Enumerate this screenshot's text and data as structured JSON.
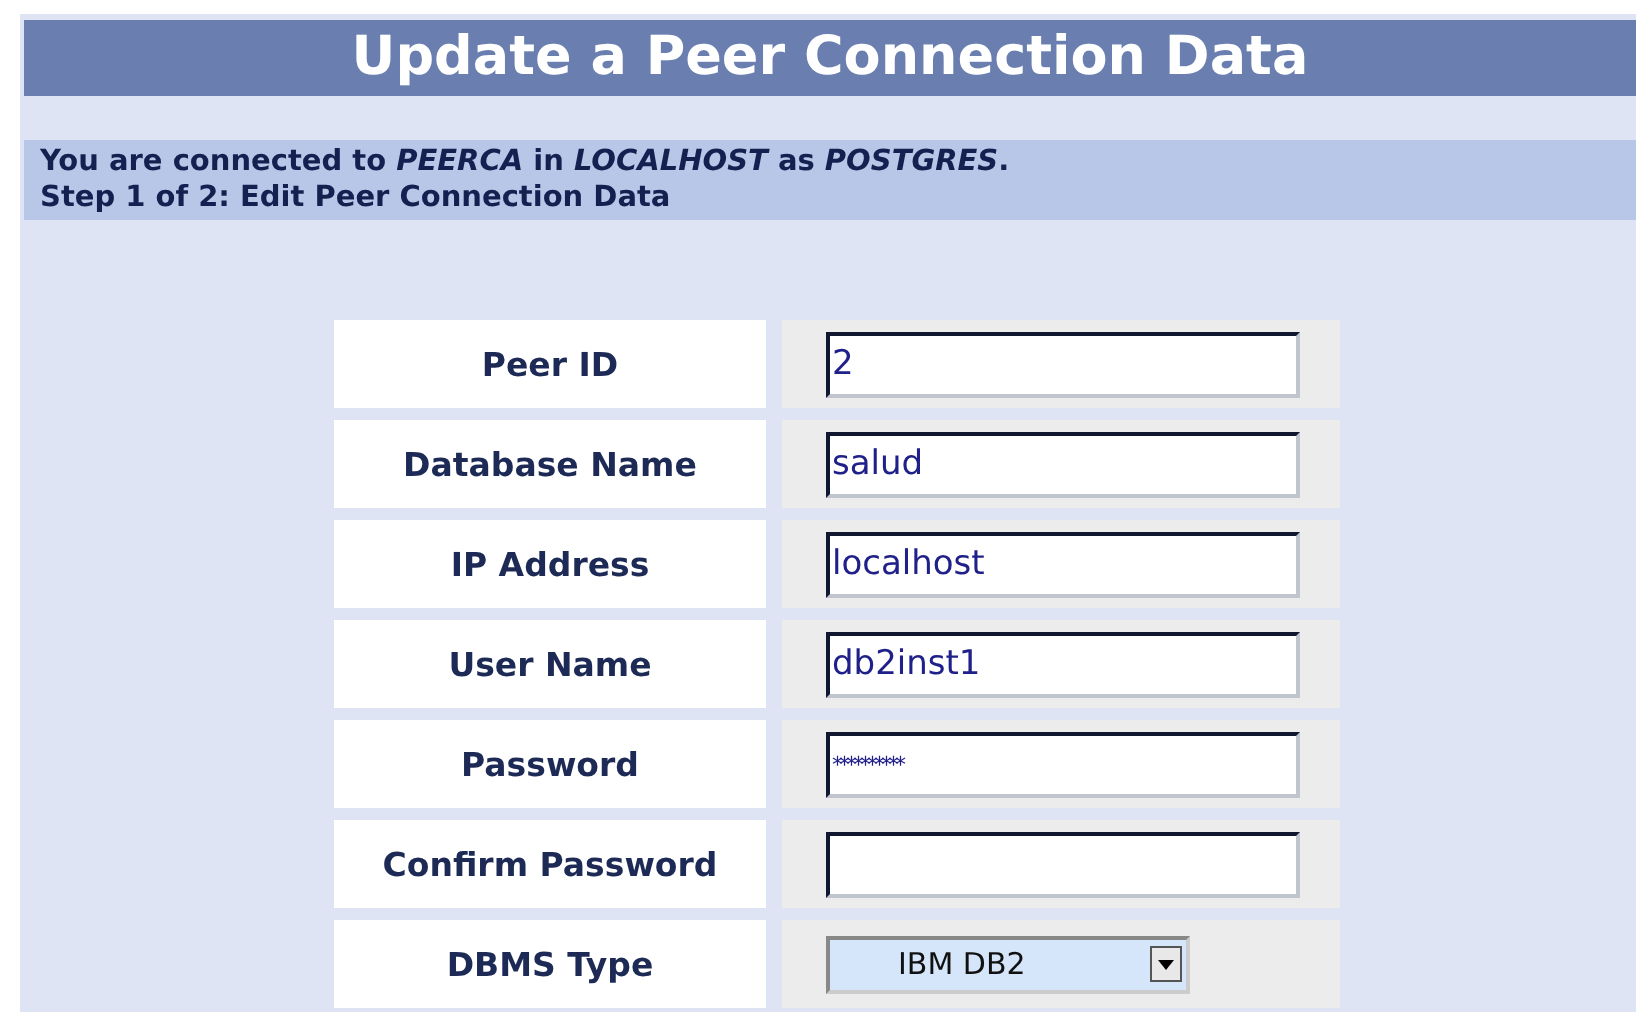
{
  "title": "Update a Peer Connection Data",
  "info": [
    "You are connected to *PEERCA* in *LOCALHOST* as *POSTGRES*.",
    "Step 1 of 2: Edit Peer Connection Data"
  ],
  "fields": [
    {
      "label": "Peer ID",
      "kind": "text",
      "value": "2"
    },
    {
      "label": "Database Name",
      "kind": "text",
      "value": "salud"
    },
    {
      "label": "IP Address",
      "kind": "text",
      "value": "localhost"
    },
    {
      "label": "User Name",
      "kind": "text",
      "value": "db2inst1"
    },
    {
      "label": "Password",
      "kind": "password",
      "value": "**********"
    },
    {
      "label": "Confirm Password",
      "kind": "password"
    },
    {
      "label": "DBMS Type",
      "kind": "select",
      "value": "IBM DB2"
    }
  ]
}
